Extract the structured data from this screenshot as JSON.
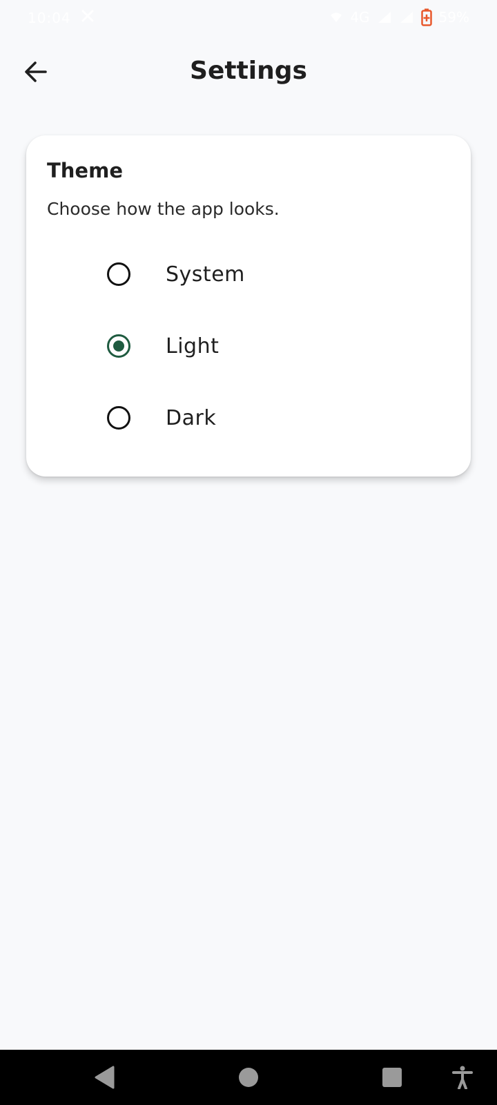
{
  "status_bar": {
    "time": "10:04",
    "network": "4G",
    "battery_percent": "59%",
    "battery_color": "#e8592c"
  },
  "app_bar": {
    "title": "Settings",
    "back_icon": "arrow-back-icon"
  },
  "theme_card": {
    "title": "Theme",
    "subtitle": "Choose how the app looks.",
    "options": [
      {
        "label": "System",
        "selected": false
      },
      {
        "label": "Light",
        "selected": true
      },
      {
        "label": "Dark",
        "selected": false
      }
    ],
    "accent_color": "#1f5b40"
  },
  "nav_bar": {
    "icons": [
      "nav-back-icon",
      "nav-home-icon",
      "nav-recents-icon",
      "accessibility-icon"
    ]
  }
}
